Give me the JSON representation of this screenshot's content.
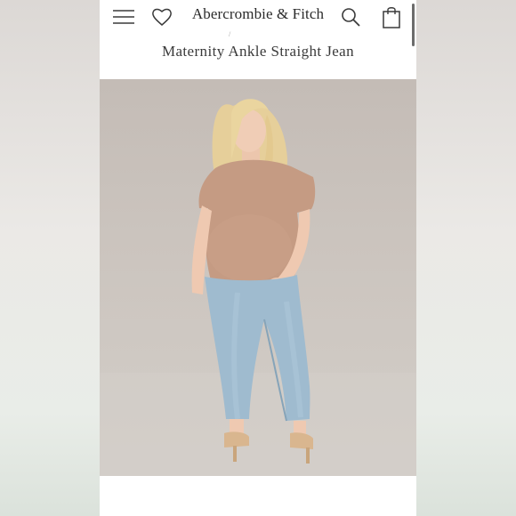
{
  "header": {
    "brand": "Abercrombie & Fitch",
    "icons": {
      "menu": "hamburger-menu-icon",
      "wishlist": "heart-icon",
      "search": "search-icon",
      "bag": "shopping-bag-icon"
    }
  },
  "product": {
    "title": "Maternity Ankle Straight Jean",
    "image_subject": "model wearing tan top and light-wash straight jeans"
  },
  "colors": {
    "page_bg": "#ffffff",
    "brand_text": "#2a2a2a",
    "image_bg": "#cbc4be",
    "top": "#c49a82",
    "denim": "#9db8cc"
  }
}
